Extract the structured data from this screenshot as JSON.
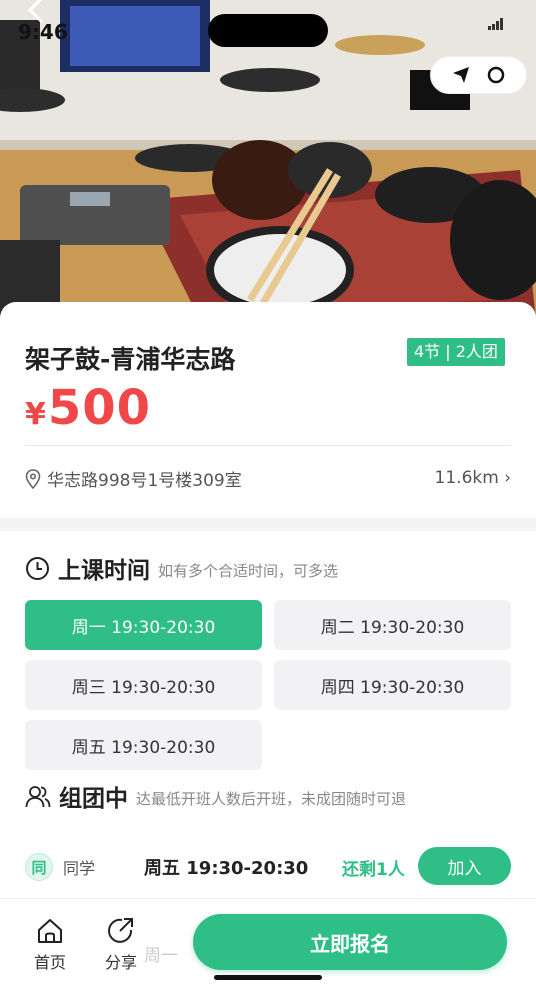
{
  "status_bar": {
    "time": "9:46"
  },
  "header": {
    "back_icon": "chevron-left-icon",
    "more_icon": "more-icon",
    "close_icon": "close-circle-icon"
  },
  "course": {
    "title": "架子鼓-青浦华志路",
    "tag": "4节 | 2人团",
    "price_currency": "¥",
    "price": "500",
    "address": "华志路998号1号楼309室",
    "distance": "11.6km ›"
  },
  "schedule": {
    "title": "上课时间",
    "hint": "如有多个合适时间，可多选",
    "slots": [
      {
        "label": "周一 19:30-20:30",
        "selected": true
      },
      {
        "label": "周二 19:30-20:30",
        "selected": false
      },
      {
        "label": "周三 19:30-20:30",
        "selected": false
      },
      {
        "label": "周四 19:30-20:30",
        "selected": false
      },
      {
        "label": "周五 19:30-20:30",
        "selected": false
      }
    ]
  },
  "group": {
    "title": "组团中",
    "hint": "达最低开班人数后开班，未成团随时可退",
    "rows": [
      {
        "badge": "同",
        "name": "同学",
        "time": "周五 19:30-20:30",
        "remaining": "还剩1人",
        "join_label": "加入"
      }
    ],
    "partial_row_time": "周一"
  },
  "bottom_bar": {
    "home_label": "首页",
    "share_label": "分享",
    "cta_label": "立即报名"
  },
  "colors": {
    "accent": "#2fbf86",
    "price": "#f04848"
  }
}
